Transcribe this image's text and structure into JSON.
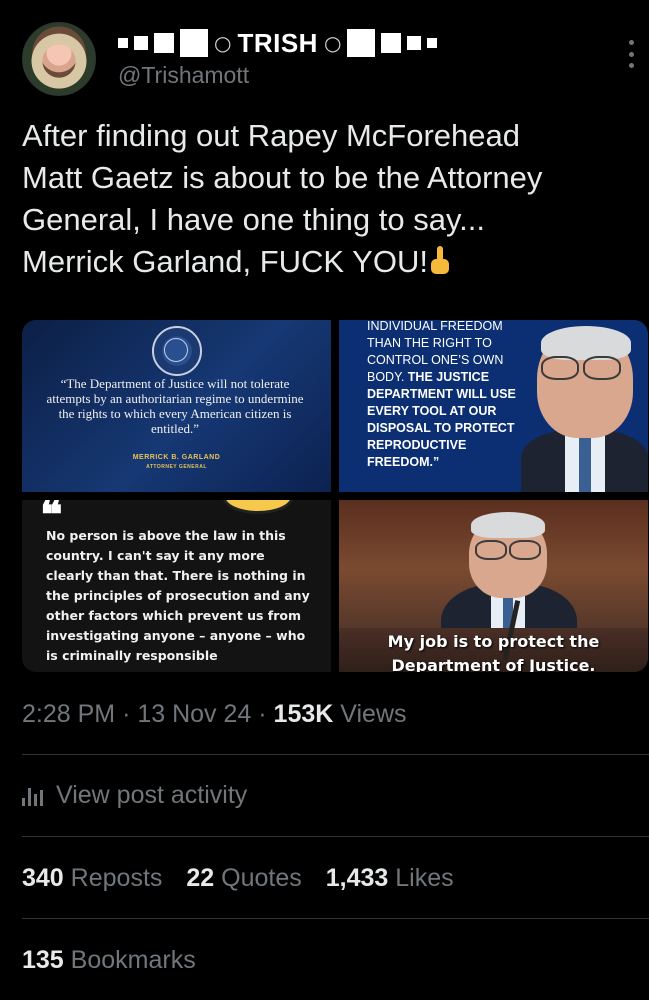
{
  "author": {
    "display_name": "TRISH",
    "handle": "@Trishamott",
    "name_decoration": "○",
    "avatar_alt": "avatar"
  },
  "tweet": {
    "text_line1": "After finding out Rapey McForehead",
    "text_line2": "Matt Gaetz is about to be the Attorney",
    "text_line3": "General, I have one thing to say...",
    "text_line4": "Merrick Garland, FUCK YOU!",
    "emoji": "middle-finger-emoji"
  },
  "media": {
    "image1": {
      "quote": "“The Department of Justice will not tolerate attempts by an authoritarian regime to undermine the rights to which every American citizen is entitled.”",
      "attribution": "MERRICK B. GARLAND",
      "attribution_title": "ATTORNEY GENERAL"
    },
    "image2": {
      "quote_normal": "INDIVIDUAL FREEDOM THAN THE RIGHT TO CONTROL ONE’S OWN BODY.",
      "quote_bold": "THE JUSTICE DEPARTMENT WILL USE EVERY TOOL AT OUR DISPOSAL TO PROTECT REPRODUCTIVE FREEDOM.”"
    },
    "image3": {
      "quote_marks": "❝",
      "quote": "No person is above the law in this country. I can't say it any more clearly than that. There is nothing in the principles of prosecution and any other factors which prevent us from investigating anyone – anyone – who is criminally responsible"
    },
    "image4": {
      "caption_line1": "My job is to protect the",
      "caption_line2": "Department of Justice."
    }
  },
  "meta": {
    "time": "2:28 PM",
    "date": "13 Nov 24",
    "views_count": "153K",
    "views_label": "Views",
    "sep": "·"
  },
  "activity": {
    "label": "View post activity",
    "icon": "analytics-icon"
  },
  "stats": {
    "reposts_count": "340",
    "reposts_label": "Reposts",
    "quotes_count": "22",
    "quotes_label": "Quotes",
    "likes_count": "1,433",
    "likes_label": "Likes",
    "bookmarks_count": "135",
    "bookmarks_label": "Bookmarks"
  },
  "colors": {
    "background": "#000000",
    "text": "#e7e9ea",
    "muted": "#71767b",
    "divider": "#2f3336"
  }
}
